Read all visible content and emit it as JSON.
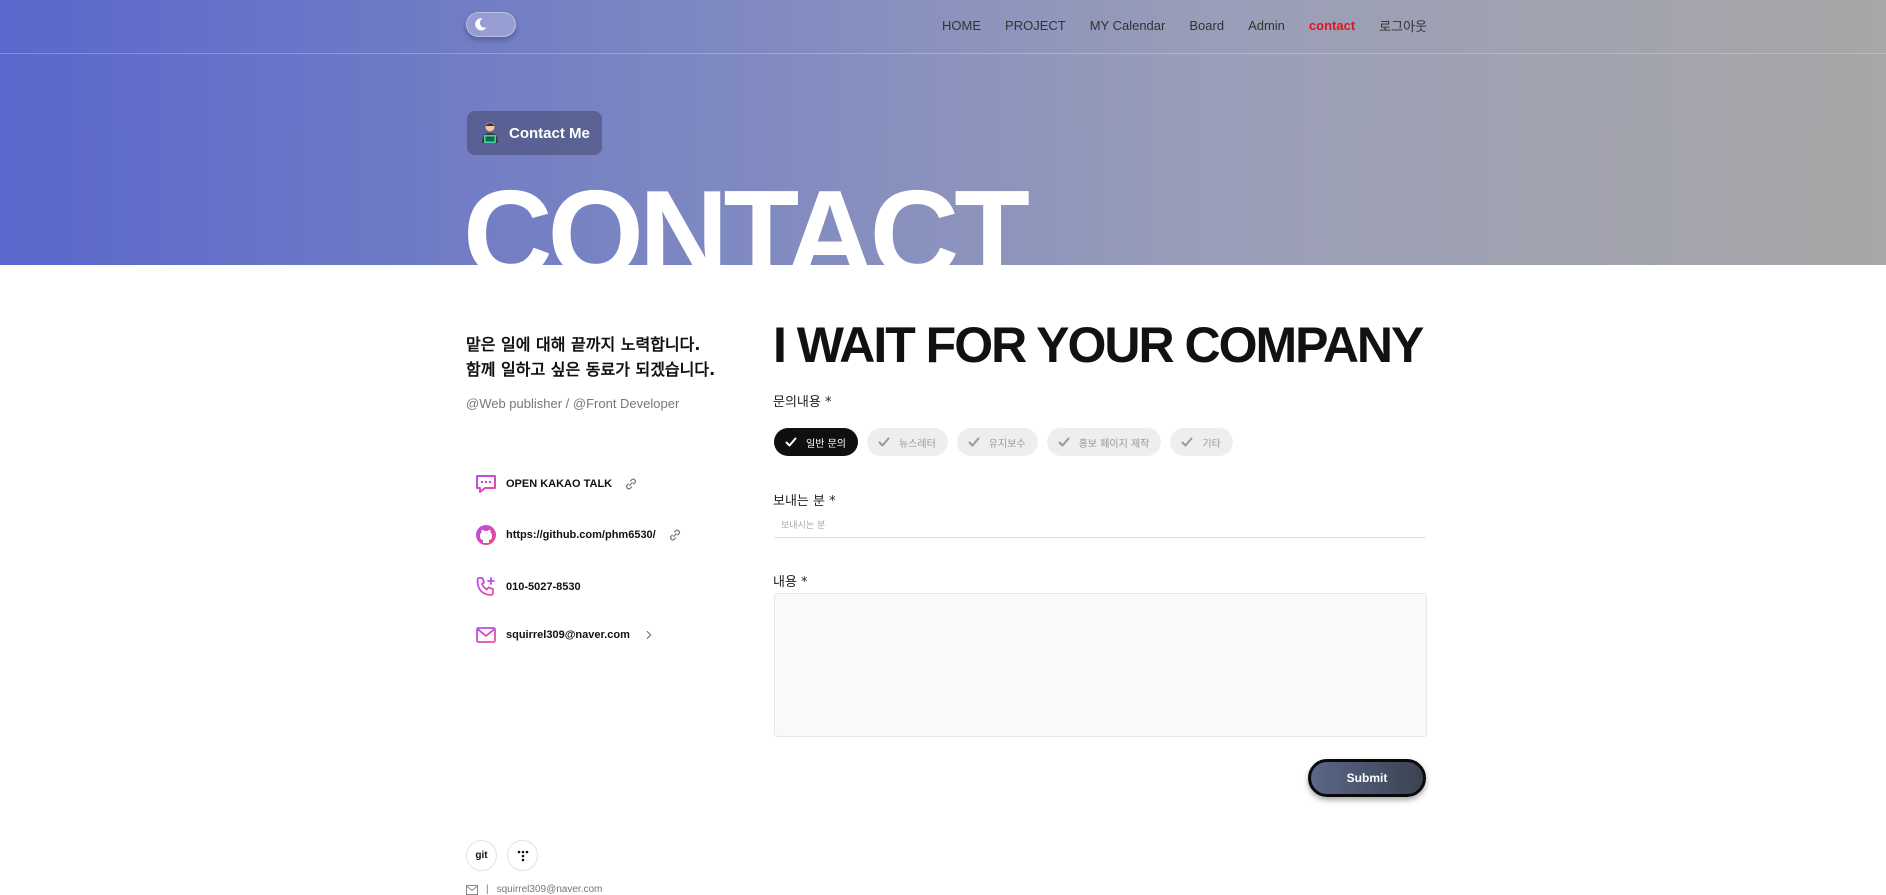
{
  "nav": {
    "items": [
      {
        "label": "HOME",
        "active": false
      },
      {
        "label": "PROJECT",
        "active": false
      },
      {
        "label": "MY Calendar",
        "active": false
      },
      {
        "label": "Board",
        "active": false
      },
      {
        "label": "Admin",
        "active": false
      },
      {
        "label": "contact",
        "active": true
      },
      {
        "label": "로그아웃",
        "active": false
      }
    ]
  },
  "hero": {
    "badge": "Contact Me",
    "title": "CONTACT"
  },
  "intro": {
    "line1": "맡은 일에 대해 끝까지 노력합니다.",
    "line2": "함께 일하고 싶은 동료가 되겠습니다.",
    "role": "@Web publisher / @Front Developer"
  },
  "contacts": [
    {
      "text": "OPEN KAKAO TALK",
      "icon": "chat-icon",
      "tail": "link-icon"
    },
    {
      "text": "https://github.com/phm6530/",
      "icon": "github-icon",
      "tail": "link-icon"
    },
    {
      "text": "010-5027-8530",
      "icon": "phone-icon",
      "tail": ""
    },
    {
      "text": "squirrel309@naver.com",
      "icon": "mail-icon",
      "tail": "chevron-right-icon"
    }
  ],
  "form": {
    "heading": "I WAIT FOR YOUR COMPANY",
    "inquiry_label": "문의내용 *",
    "categories": [
      {
        "label": "일반 문의",
        "selected": true
      },
      {
        "label": "뉴스레터",
        "selected": false
      },
      {
        "label": "유지보수",
        "selected": false
      },
      {
        "label": "홍보 페이지 제작",
        "selected": false
      },
      {
        "label": "기타",
        "selected": false
      }
    ],
    "sender_label": "보내는 분 *",
    "sender_placeholder": "보내시는 분",
    "content_label": "내용 *",
    "submit": "Submit"
  },
  "footer": {
    "git_label": "git",
    "email": "squirrel309@naver.com"
  },
  "colors": {
    "accent_active": "#e3141f",
    "gradient_start": "#5b67cc",
    "gradient_end": "#a7a7a7"
  }
}
